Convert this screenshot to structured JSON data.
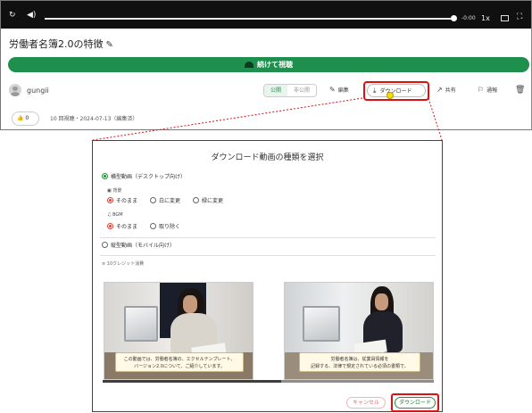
{
  "player": {
    "time": "-0:00",
    "rate": "1x"
  },
  "video": {
    "title": "労働者名簿2.0の特徴",
    "continue_button": "続けて視聴"
  },
  "owner": {
    "name": "gungii"
  },
  "visibility": {
    "public": "公開",
    "private": "非公開"
  },
  "actions": {
    "edit": "編集",
    "download": "ダウンロード",
    "share": "共有",
    "report": "通報"
  },
  "stats": {
    "likes": "0",
    "meta": "10 回視聴・2024-07-13（編集済）"
  },
  "dialog": {
    "title": "ダウンロード動画の種類を選択",
    "landscape_option": "横型動画（デスクトップ向け）",
    "background_label": "背景",
    "background_options": [
      "そのまま",
      "白に変更",
      "緑に変更"
    ],
    "bgm_label": "BGM",
    "bgm_options": [
      "そのまま",
      "取り除く"
    ],
    "portrait_option": "縦型動画（モバイル向け）",
    "credits": "10クレジット消費",
    "thumb1_caption_1": "この動画では、労働者名簿の、エクセルテンプレート、",
    "thumb1_caption_2": "バージョン2.0について、ご紹介しています。",
    "thumb2_caption_1": "労働者名簿は、従業員情報を",
    "thumb2_caption_2": "記録する、法律で規定されている必須の書類で、",
    "cancel": "キャンセル",
    "download": "ダウンロード"
  },
  "colors": {
    "accent_green": "#1e8f4c",
    "highlight_red": "#dd1111",
    "radio_red": "#e0413a"
  },
  "icons": {
    "replay": "replay-icon",
    "volume": "volume-icon",
    "pip": "pip-icon",
    "fullscreen": "fullscreen-icon",
    "pencil": "pencil-icon",
    "download": "download-icon",
    "share": "share-icon",
    "flag": "flag-icon",
    "trash": "trash-icon",
    "thumbs_up": "thumbs-up-icon",
    "image": "image-icon",
    "music": "music-icon"
  }
}
